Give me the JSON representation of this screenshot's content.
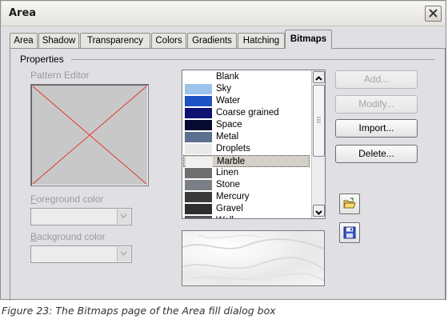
{
  "window": {
    "title": "Area"
  },
  "tabs": [
    "Area",
    "Shadow",
    "Transparency",
    "Colors",
    "Gradients",
    "Hatching",
    "Bitmaps"
  ],
  "active_tab": "Bitmaps",
  "properties": {
    "group_label": "Properties",
    "pattern_editor_label": "Pattern Editor",
    "foreground_color_label": "Foreground color",
    "background_color_label": "Background color",
    "foreground_color_value": "",
    "background_color_value": ""
  },
  "bitmaps": {
    "items": [
      {
        "label": "Blank",
        "swatch": "#ffffff"
      },
      {
        "label": "Sky",
        "swatch": "#9cc3ea"
      },
      {
        "label": "Water",
        "swatch": "#1f52c2"
      },
      {
        "label": "Coarse grained",
        "swatch": "#0d1270"
      },
      {
        "label": "Space",
        "swatch": "#050a2e"
      },
      {
        "label": "Metal",
        "swatch": "#5b6f8f"
      },
      {
        "label": "Droplets",
        "swatch": "#e9e9e9"
      },
      {
        "label": "Marble",
        "swatch": "#f0f0f0"
      },
      {
        "label": "Linen",
        "swatch": "#6f6f6f"
      },
      {
        "label": "Stone",
        "swatch": "#7a7f86"
      },
      {
        "label": "Mercury",
        "swatch": "#3a3a3a"
      },
      {
        "label": "Gravel",
        "swatch": "#2e2e2e"
      },
      {
        "label": "Wall",
        "swatch": "#555555"
      }
    ],
    "selected": "Marble"
  },
  "buttons": {
    "add": "Add...",
    "modify": "Modify...",
    "import": "Import...",
    "delete": "Delete..."
  },
  "caption": "Figure 23: The Bitmaps page of the Area fill dialog box"
}
